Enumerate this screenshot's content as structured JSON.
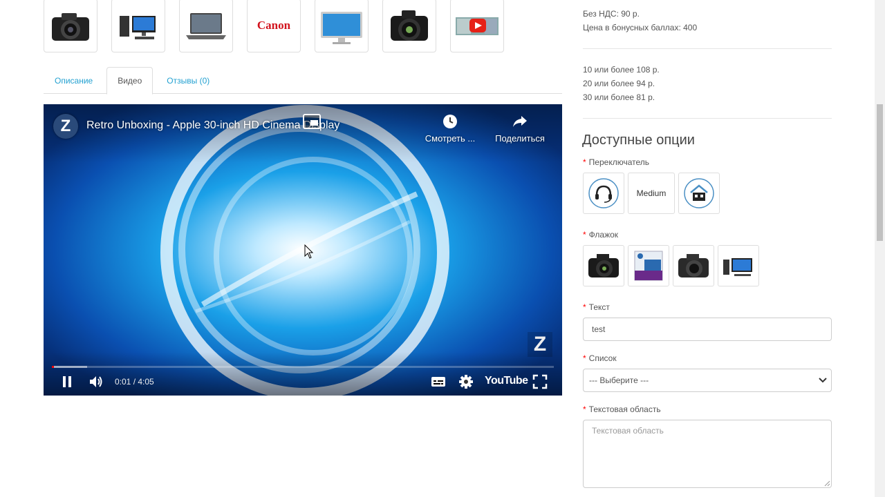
{
  "thumbnails": [
    {
      "name": "camera-black"
    },
    {
      "name": "desktop-computer"
    },
    {
      "name": "laptop"
    },
    {
      "name": "canon-logo",
      "text": "Canon"
    },
    {
      "name": "monitor"
    },
    {
      "name": "camera-pro"
    },
    {
      "name": "youtube-video"
    }
  ],
  "tabs": [
    {
      "label": "Описание",
      "active": false
    },
    {
      "label": "Видео",
      "active": true
    },
    {
      "label": "Отзывы (0)",
      "active": false
    }
  ],
  "video": {
    "title": "Retro Unboxing - Apple 30-inch HD Cinema Display",
    "channel_letter": "Z",
    "watch_later": "Смотреть ...",
    "share": "Поделиться",
    "time": "0:01 / 4:05",
    "brand": "YouTube",
    "progress_played": 0.004,
    "progress_buffered": 0.07
  },
  "price": {
    "no_vat": "Без НДС: 90 р.",
    "bonus": "Цена в бонусных баллах: 400"
  },
  "discounts": [
    "10 или более 108 р.",
    "20 или более 94 р.",
    "30 или более 81 р."
  ],
  "options": {
    "title": "Доступные опции",
    "radio_label": "Переключатель",
    "radio_items": [
      {
        "name": "headset-icon"
      },
      {
        "text": "Medium"
      },
      {
        "name": "home-icon"
      }
    ],
    "checkbox_label": "Флажок",
    "checkbox_items": [
      "camera",
      "hp-box",
      "camera-2",
      "desktop"
    ],
    "text_label": "Текст",
    "text_value": "test",
    "select_label": "Список",
    "select_value": "--- Выберите ---",
    "textarea_label": "Текстовая область",
    "textarea_placeholder": "Текстовая область",
    "required_mark": "*"
  },
  "colors": {
    "link": "#23a1d1",
    "required": "#ff0000",
    "youtube_red": "#ff0000"
  }
}
